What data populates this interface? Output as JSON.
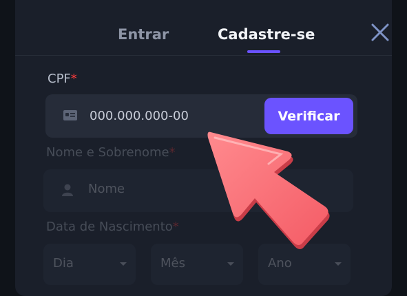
{
  "tabs": {
    "login_label": "Entrar",
    "signup_label": "Cadastre-se"
  },
  "cpf": {
    "label": "CPF",
    "required_mark": "*",
    "placeholder": "000.000.000-00",
    "verify_label": "Verificar",
    "icon": "id-card-icon"
  },
  "name": {
    "label": "Nome e Sobrenome",
    "required_mark": "*",
    "placeholder": "Nome",
    "icon": "user-icon"
  },
  "birth": {
    "label": "Data de Nascimento",
    "required_mark": "*",
    "day": "Dia",
    "month": "Mês",
    "year": "Ano"
  },
  "colors": {
    "accent": "#6b53ff",
    "required": "#ff3b3b",
    "pointer": "#ff7a7f"
  }
}
